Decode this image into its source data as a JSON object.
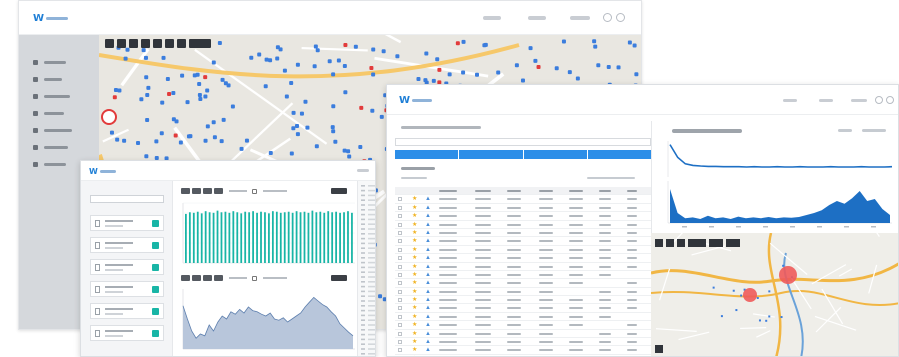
{
  "colors": {
    "brand": "#1f7fd6",
    "teal": "#18b5a6",
    "chart_blue": "#1d6fc4",
    "area_fill": "#b8c6db",
    "map_blue_marker": "#3b7ddd",
    "map_red_marker": "#e23b3b",
    "map_circle": "#ee5a5a",
    "tab_blue": "#2c8ee8",
    "star": "#f0b323"
  },
  "icons": {
    "brand_logo": "wave-logo-icon",
    "window_controls": [
      "settings-icon",
      "profile-icon"
    ],
    "map_pin": "location-pin-icon"
  },
  "chart_data": [
    {
      "type": "bar",
      "series": [
        {
          "values": [
            0.9,
            0.93,
            0.92,
            0.94,
            0.91,
            0.95,
            0.93,
            0.92,
            0.96,
            0.93,
            0.94,
            0.92,
            0.95,
            0.93,
            0.91,
            0.94,
            0.93,
            0.95,
            0.92,
            0.94,
            0.93,
            0.91,
            0.95,
            0.94,
            0.92,
            0.93,
            0.94,
            0.92,
            0.95,
            0.93,
            0.94,
            0.92,
            0.96,
            0.93,
            0.94,
            0.92,
            0.95,
            0.93,
            0.94,
            0.92,
            0.93,
            0.95,
            0.92
          ]
        }
      ],
      "ylim": [
        0,
        1.1
      ]
    },
    {
      "type": "area",
      "series": [
        {
          "values": [
            0.72,
            0.5,
            0.3,
            0.18,
            0.25,
            0.22,
            0.4,
            0.3,
            0.45,
            0.55,
            0.5,
            0.62,
            0.58,
            0.66,
            0.6,
            0.7,
            0.64,
            0.62,
            0.58,
            0.55,
            0.6,
            0.5,
            0.48,
            0.52,
            0.45,
            0.5,
            0.55,
            0.6,
            0.7,
            0.78,
            0.86,
            0.8,
            0.74,
            0.7,
            0.62,
            0.55,
            0.42,
            0.35,
            0.28,
            0.22
          ]
        }
      ],
      "ylim": [
        0,
        1
      ]
    },
    {
      "type": "line",
      "series": [
        {
          "values": [
            0.95,
            0.55,
            0.35,
            0.3,
            0.28,
            0.27,
            0.27,
            0.26,
            0.26,
            0.26,
            0.25,
            0.26,
            0.25,
            0.25,
            0.26,
            0.25,
            0.25,
            0.26,
            0.25,
            0.25,
            0.25,
            0.26,
            0.25,
            0.25,
            0.25,
            0.26,
            0.25,
            0.25,
            0.25,
            0.26
          ]
        }
      ],
      "ylim": [
        0,
        1
      ]
    },
    {
      "type": "area",
      "series": [
        {
          "values": [
            0.85,
            0.25,
            0.12,
            0.14,
            0.1,
            0.18,
            0.12,
            0.14,
            0.1,
            0.16,
            0.12,
            0.14,
            0.12,
            0.15,
            0.12,
            0.14,
            0.13,
            0.15,
            0.2,
            0.25,
            0.32,
            0.45,
            0.55,
            0.48,
            0.62,
            0.8,
            0.55,
            0.6,
            0.35,
            0.2
          ]
        }
      ],
      "ylim": [
        0,
        1
      ]
    }
  ],
  "table": {
    "header_count": 1,
    "row_count": 20
  }
}
